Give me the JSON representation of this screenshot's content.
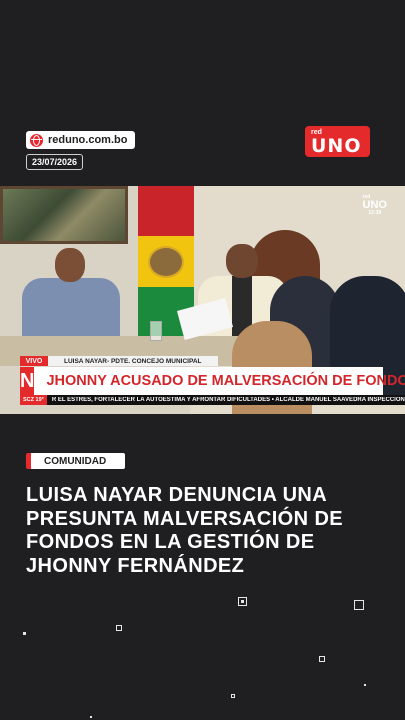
{
  "header": {
    "site": "reduno.com.bo",
    "date": "23/07/2026",
    "logo_small": "red",
    "logo_big": "UNO"
  },
  "video": {
    "logo_small": "red",
    "logo_big": "UNO",
    "clock": "12:39",
    "live_label": "VIVO",
    "speaker": "LUISA NAYAR- PDTE. CONCEJO MUNICIPAL",
    "n_badge": "N",
    "headline": "JHONNY ACUSADO DE MALVERSACIÓN DE FONDOS",
    "location": "SCZ 19°",
    "ticker": "R EL ESTRÉS, FORTALECER LA AUTOESTIMA Y AFRONTAR DIFICULTADES  •  ALCALDE MANUEL SAAVEDRA INSPECCIONÓ HO"
  },
  "article": {
    "category": "COMUNIDAD",
    "title": "LUISA NAYAR DENUNCIA UNA PRESUNTA MALVERSACIÓN DE FONDOS EN LA GESTIÓN DE JHONNY FERNÁNDEZ"
  },
  "colors": {
    "background": "#1f1f22",
    "accent": "#e52a2c"
  },
  "icons": [
    "globe-icon"
  ]
}
